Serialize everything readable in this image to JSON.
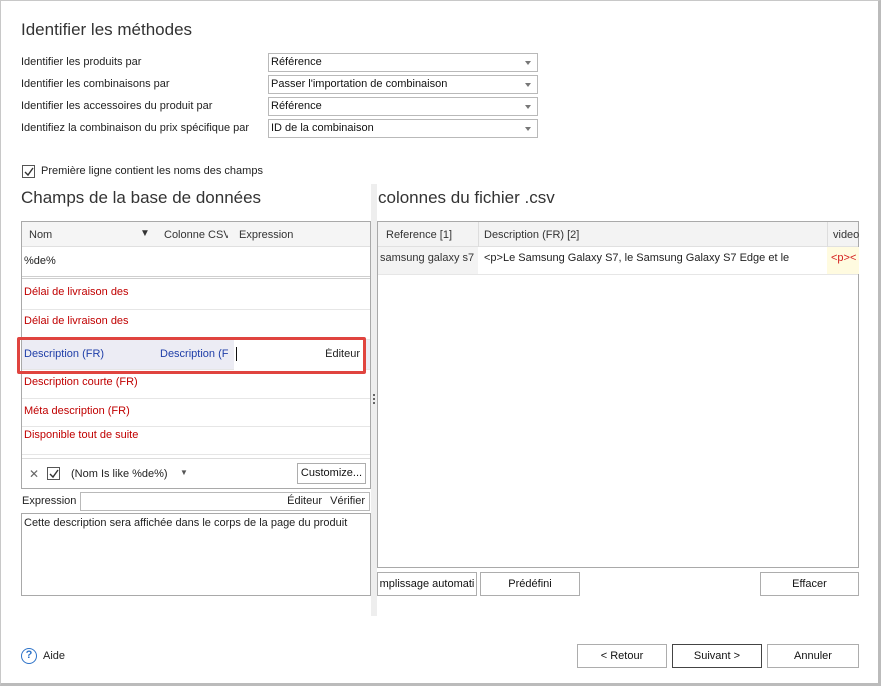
{
  "section1": {
    "title": "Identifier les méthodes",
    "fields": [
      {
        "label": "Identifier les produits par",
        "value": "Référence"
      },
      {
        "label": "Identifier les combinaisons par",
        "value": "Passer l'importation de combinaison"
      },
      {
        "label": "Identifier les accessoires du produit par",
        "value": "Référence"
      },
      {
        "label": "Identifiez la combinaison du prix spécifique par",
        "value": "ID de la combinaison"
      }
    ],
    "checkbox_label": "Première ligne contient les noms des champs"
  },
  "db_fields": {
    "title": "Champs de la base de données",
    "columns": {
      "name": "Nom",
      "csv": "Colonne CSV",
      "expression": "Expression"
    },
    "filter_value": "%de%",
    "rows": [
      {
        "name": "Délai de livraison des",
        "csv": "",
        "expr": ""
      },
      {
        "name": "Délai de livraison des",
        "csv": "",
        "expr": ""
      },
      {
        "name": "Description (FR)",
        "csv": "Description (F",
        "expr": "",
        "editor": "Éditeur"
      },
      {
        "name": "Description courte (FR)",
        "csv": "",
        "expr": ""
      },
      {
        "name": "Méta description (FR)",
        "csv": "",
        "expr": ""
      },
      {
        "name": "Disponible tout de suite",
        "csv": "",
        "expr": ""
      }
    ],
    "filter_bar": {
      "text": "(Nom Is like %de%)",
      "customize": "Customize..."
    },
    "expression_label": "Expression",
    "editor_btn": "Éditeur",
    "verify_btn": "Vérifier",
    "description": "Cette description sera affichée dans le corps de la page du produit"
  },
  "csv": {
    "title": "colonnes du fichier .csv",
    "columns": [
      "Reference [1]",
      "Description (FR) [2]",
      "video"
    ],
    "row": [
      "samsung galaxy s7",
      "<p>Le Samsung Galaxy S7, le Samsung Galaxy S7 Edge et le",
      "<p><"
    ],
    "buttons": {
      "autofill": "mplissage automati",
      "predefined": "Prédéfini",
      "clear": "Effacer"
    }
  },
  "footer": {
    "help": "Aide",
    "back": "< Retour",
    "next": "Suivant >",
    "cancel": "Annuler"
  },
  "colors": {
    "highlight": "#e0443f",
    "accent_blue": "#1f3ea8",
    "required_red": "#c00000",
    "help_icon": "#2e73c8"
  }
}
